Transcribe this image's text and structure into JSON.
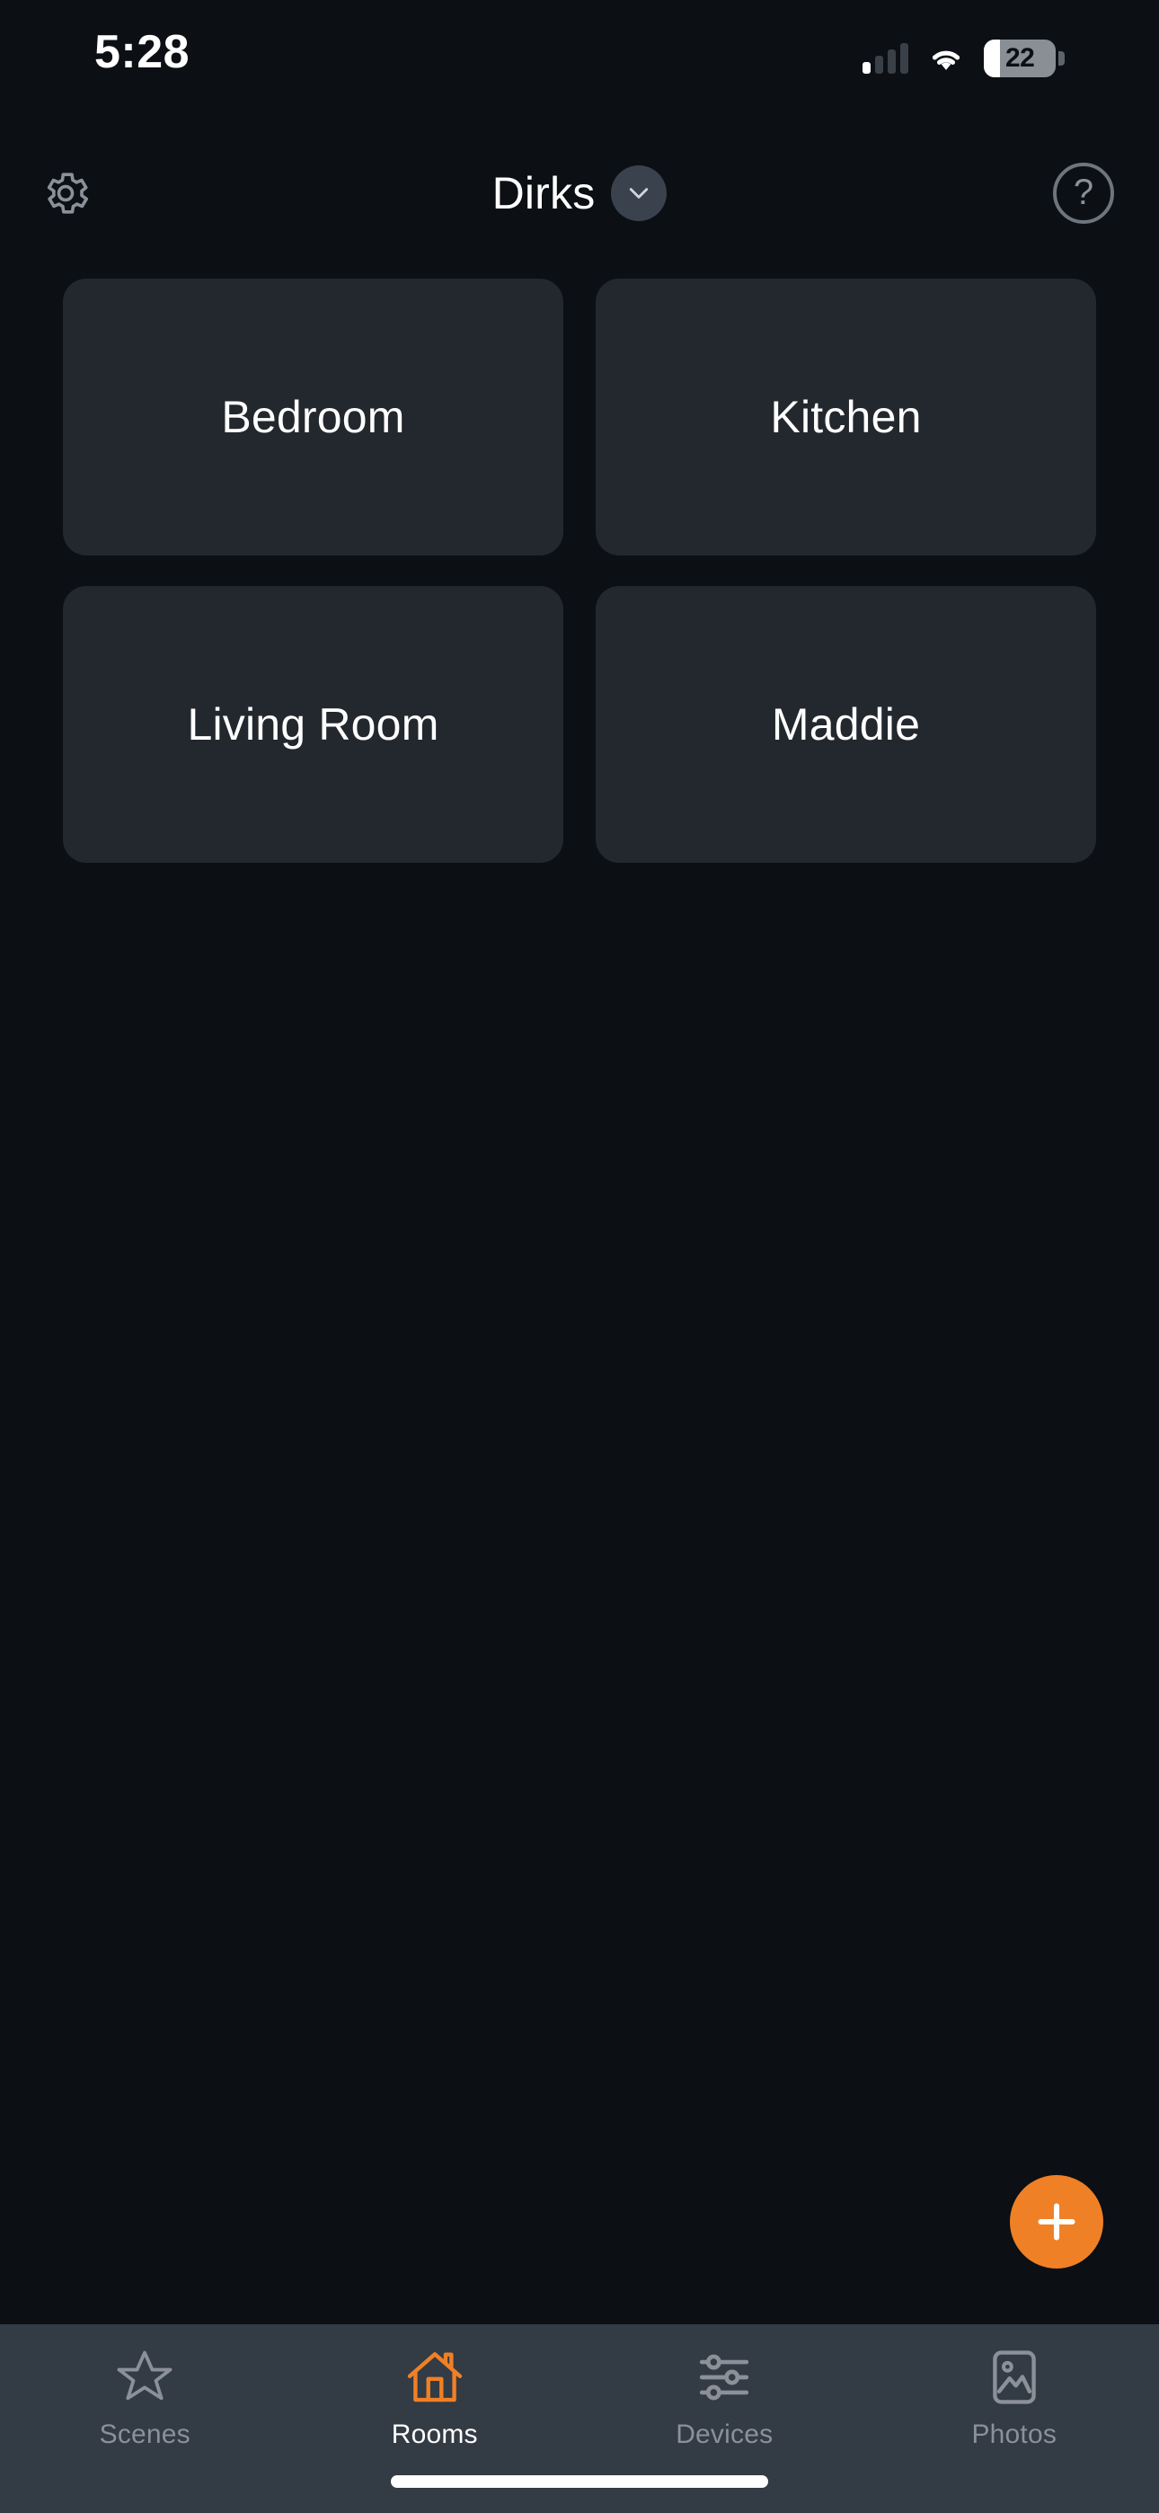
{
  "status_bar": {
    "time": "5:28",
    "battery_level": "22",
    "signal_icon": "cellular-signal-icon",
    "wifi_icon": "wifi-icon",
    "battery_icon": "battery-icon"
  },
  "header": {
    "settings_icon": "gear-icon",
    "home_name": "Dirks",
    "chevron_icon": "chevron-down-icon",
    "help_label": "?"
  },
  "rooms": [
    {
      "name": "Bedroom"
    },
    {
      "name": "Kitchen"
    },
    {
      "name": "Living Room"
    },
    {
      "name": "Maddie"
    }
  ],
  "fab": {
    "label": "+",
    "icon": "plus-icon",
    "color": "#f08025"
  },
  "tabbar": {
    "items": [
      {
        "label": "Scenes",
        "icon": "star-icon",
        "active": false
      },
      {
        "label": "Rooms",
        "icon": "house-icon",
        "active": true
      },
      {
        "label": "Devices",
        "icon": "sliders-icon",
        "active": false
      },
      {
        "label": "Photos",
        "icon": "photo-icon",
        "active": false
      }
    ]
  },
  "colors": {
    "page_background": "#0c0f14",
    "card_background": "#23282e",
    "tabbar_background": "#333b45",
    "accent": "#f08025",
    "inactive": "#8b9099"
  }
}
